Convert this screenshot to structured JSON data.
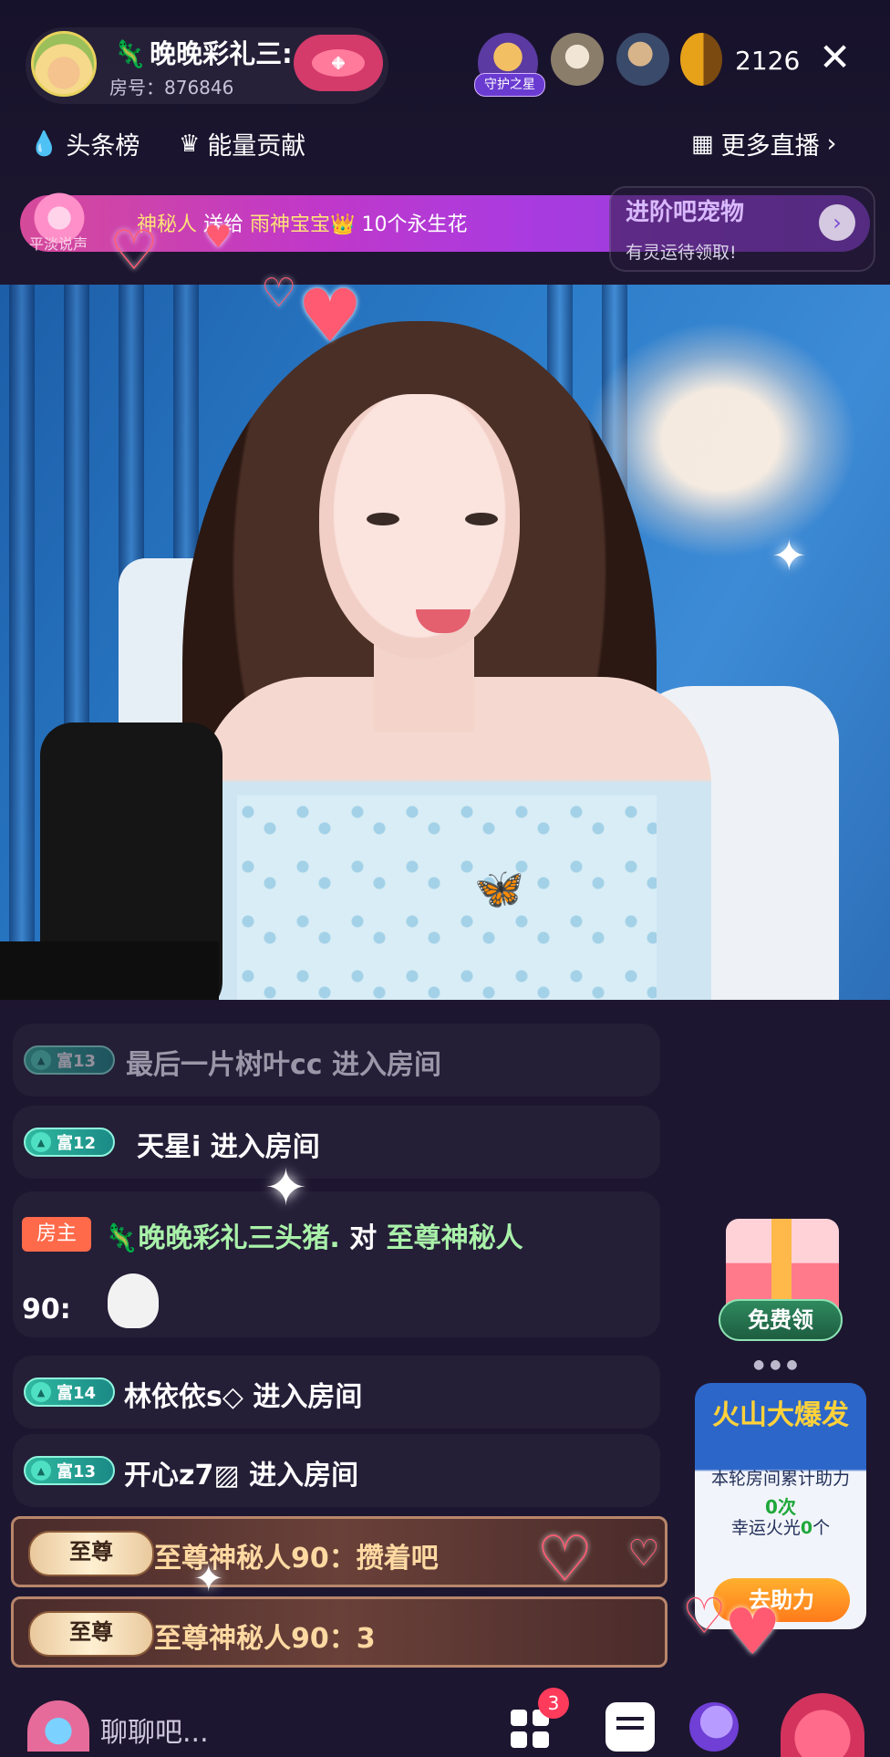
{
  "header": {
    "host_name": "晚晚彩礼三:",
    "room_label": "房号：876846",
    "guard_label": "守护之星",
    "viewer_count": "2126",
    "close_icon": "close-icon"
  },
  "tabs": {
    "headline": "头条榜",
    "energy": "能量贡献",
    "more": "更多直播"
  },
  "banner": {
    "sender": "神秘人",
    "verb": "送给",
    "target": "雨神宝宝",
    "gift": "10个永生花",
    "sub": "平淡说声"
  },
  "promo": {
    "title": "进阶吧宠物",
    "sub": "有灵运待领取!"
  },
  "chat": {
    "rows": [
      {
        "level": "富13",
        "name": "最后一片树叶cc",
        "action": "进入房间"
      },
      {
        "level": "富12",
        "name": "天星i",
        "action": "进入房间"
      },
      {
        "level": "富14",
        "name": "林依依s◇",
        "action": "进入房间"
      },
      {
        "level": "富13",
        "name": "开心z7▨",
        "action": "进入房间"
      }
    ],
    "host_msg": {
      "tag": "房主",
      "name": "晚晚彩礼三头猪.",
      "to": "对",
      "target": "至尊神秘人",
      "suffix": "90:"
    },
    "vip": [
      {
        "badge": "至尊",
        "text": "至尊神秘人90：攒着吧"
      },
      {
        "badge": "至尊",
        "text": "至尊神秘人90：3"
      }
    ]
  },
  "widgets": {
    "free_label": "免费领",
    "volcano_title": "火山大爆发",
    "volcano_sub": "本轮房间累计助力",
    "volcano_count": "0次",
    "lucky_label": "幸运火光",
    "lucky_value": "0",
    "lucky_unit": "个",
    "help_label": "去助力"
  },
  "bottom": {
    "input_placeholder": "聊聊吧...",
    "apps_badge": "3"
  }
}
